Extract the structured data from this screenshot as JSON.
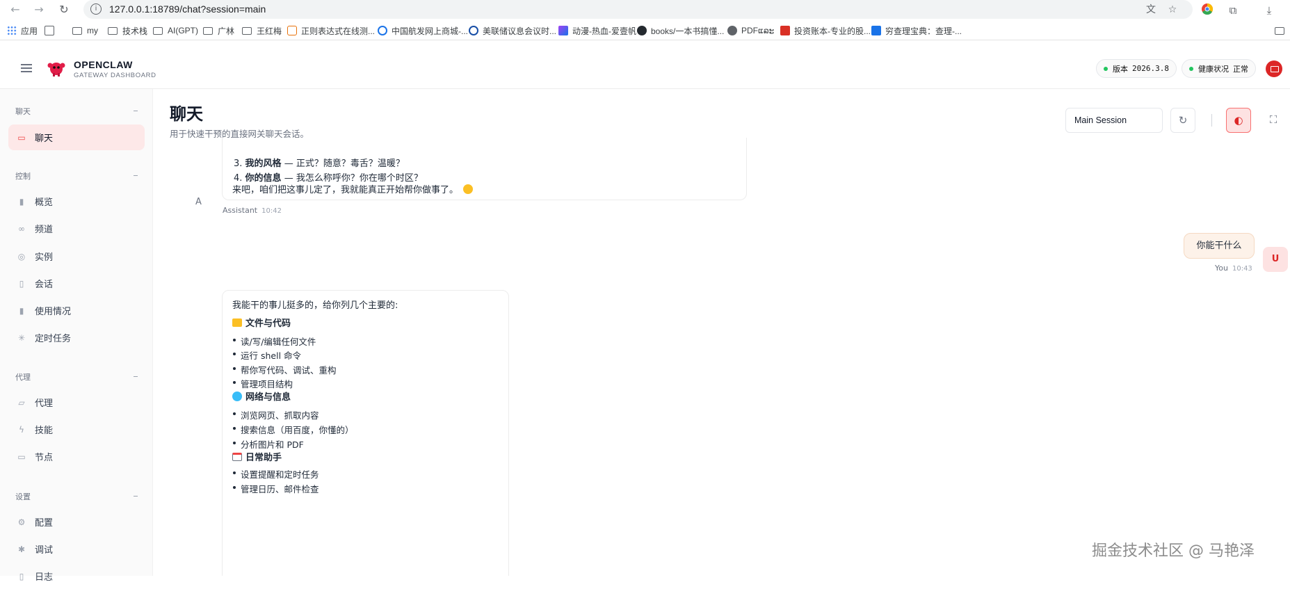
{
  "browser": {
    "url": "127.0.0.1:18789/chat?session=main",
    "bookmarks": [
      {
        "label": "应用"
      },
      {
        "label": "my"
      },
      {
        "label": "技术栈"
      },
      {
        "label": "AI(GPT)"
      },
      {
        "label": "广林"
      },
      {
        "label": "王红梅"
      },
      {
        "label": "正则表达式在线测..."
      },
      {
        "label": "中国航发网上商城-..."
      },
      {
        "label": "美联储议息会议时..."
      },
      {
        "label": "动漫-热血-爱壹帆"
      },
      {
        "label": "books/一本书搞懂..."
      },
      {
        "label": "PDFແລະ"
      },
      {
        "label": "投资账本-专业的股..."
      },
      {
        "label": "穷查理宝典：查理-..."
      }
    ]
  },
  "header": {
    "brand_title": "OPENCLAW",
    "brand_sub": "GATEWAY DASHBOARD",
    "version_label": "版本",
    "version_value": "2026.3.8",
    "health_label": "健康状况",
    "health_value": "正常"
  },
  "sidebar": {
    "sections": [
      {
        "label": "聊天",
        "items": [
          {
            "label": "聊天",
            "icon": "message-icon",
            "active": true
          }
        ]
      },
      {
        "label": "控制",
        "items": [
          {
            "label": "概览",
            "icon": "bar-chart-icon"
          },
          {
            "label": "频道",
            "icon": "link-icon"
          },
          {
            "label": "实例",
            "icon": "radio-icon"
          },
          {
            "label": "会话",
            "icon": "document-icon"
          },
          {
            "label": "使用情况",
            "icon": "bar-chart-icon"
          },
          {
            "label": "定时任务",
            "icon": "loader-icon"
          }
        ]
      },
      {
        "label": "代理",
        "items": [
          {
            "label": "代理",
            "icon": "folder-icon"
          },
          {
            "label": "技能",
            "icon": "zap-icon"
          },
          {
            "label": "节点",
            "icon": "monitor-icon"
          }
        ]
      },
      {
        "label": "设置",
        "items": [
          {
            "label": "配置",
            "icon": "gear-icon"
          },
          {
            "label": "调试",
            "icon": "bug-icon"
          },
          {
            "label": "日志",
            "icon": "file-icon"
          }
        ]
      }
    ]
  },
  "main": {
    "title": "聊天",
    "subtitle": "用于快速干预的直接网关聊天会话。",
    "session_select": "Main Session"
  },
  "chat": {
    "msg1": {
      "line3_num": "3.",
      "line3_bold": "我的风格",
      "line3_rest": " — 正式？随意？毒舌？温暖？",
      "line4_num": "4.",
      "line4_bold": "你的信息",
      "line4_rest": " — 我怎么称呼你？你在哪个时区？",
      "closing": "来吧，咱们把这事儿定了，我就能真正开始帮你做事了。",
      "avatar": "A",
      "sender": "Assistant",
      "time": "10:42"
    },
    "msg2": {
      "text": "你能干什么",
      "avatar": "U",
      "sender": "You",
      "time": "10:43"
    },
    "msg3": {
      "intro": "我能干的事儿挺多的，给你列几个主要的:",
      "h1": "文件与代码",
      "h1_items": [
        "读/写/编辑任何文件",
        "运行 shell 命令",
        "帮你写代码、调试、重构",
        "管理项目结构"
      ],
      "h2": "网络与信息",
      "h2_items": [
        "浏览网页、抓取内容",
        "搜索信息（用百度，你懂的）",
        "分析图片和 PDF"
      ],
      "h3": "日常助手",
      "h3_items": [
        "设置提醒和定时任务",
        "管理日历、邮件检查"
      ]
    }
  },
  "watermark": "掘金技术社区 @ 马艳泽"
}
